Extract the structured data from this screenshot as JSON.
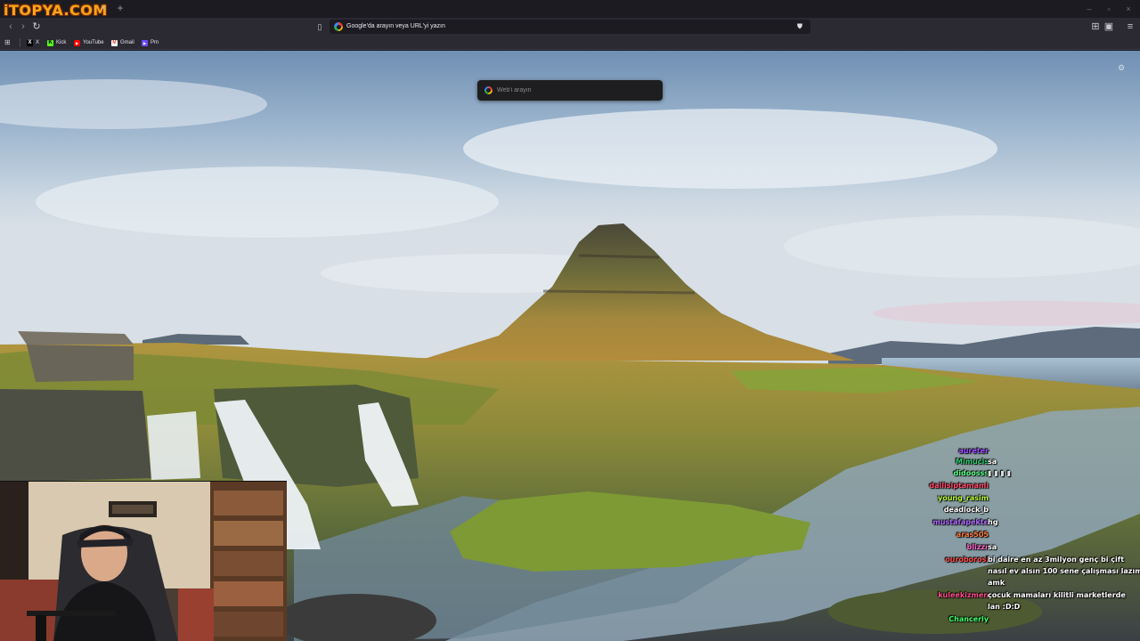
{
  "watermark": {
    "text": "iTOPYA.COM"
  },
  "tabbar": {
    "close_glyph": "×",
    "new_tab_glyph": "+",
    "window_controls": [
      "–",
      "▫",
      "×"
    ]
  },
  "navbar": {
    "back_glyph": "‹",
    "forward_glyph": "›",
    "reload_glyph": "↻",
    "bookmark_glyph": "▯",
    "url_placeholder": "Google'da arayın veya URL'yi yazın",
    "shield_glyph": "⛊",
    "right_icons": [
      "⊞",
      "▣",
      "≡"
    ]
  },
  "bookmarks": {
    "apps_glyph": "⊞",
    "items": [
      {
        "label": "X",
        "icon": "x-icon",
        "glyph": "𝕏",
        "color": "#ffffff",
        "bg": "#000000"
      },
      {
        "label": "Kick",
        "icon": "kick-icon",
        "glyph": "K",
        "color": "#000000",
        "bg": "#53fc18"
      },
      {
        "label": "YouTube",
        "icon": "youtube-icon",
        "glyph": "▶",
        "color": "#ffffff",
        "bg": "#ff0000"
      },
      {
        "label": "Gmail",
        "icon": "gmail-icon",
        "glyph": "M",
        "color": "#ea4335",
        "bg": "#ffffff"
      },
      {
        "label": "Pm",
        "icon": "proton-icon",
        "glyph": "▶",
        "color": "#ffffff",
        "bg": "#6d4aff"
      }
    ]
  },
  "newtab": {
    "search_placeholder": "Web'i arayın",
    "settings_glyph": "⚙"
  },
  "chat": {
    "messages": [
      {
        "user": "aureter",
        "user_color": "#9b4dff",
        "text": ""
      },
      {
        "user": "Mimucis",
        "user_color": "#2ecc71",
        "text": "sa"
      },
      {
        "user": "didoosss",
        "user_color": "#5cff8a",
        "text": "▮ ▮ ▮ ▮"
      },
      {
        "user": "dailisiptamami",
        "user_color": "#ff4d6d",
        "text": ""
      },
      {
        "user": "young_rasim",
        "user_color": "#b7ff3c",
        "text": ""
      },
      {
        "user": "deadlock_b",
        "user_color": "#ffffff",
        "text": ""
      },
      {
        "user": "mustafapekte",
        "user_color": "#b06bff",
        "text": "hg"
      },
      {
        "user": "aras505",
        "user_color": "#ff7a3c",
        "text": ""
      },
      {
        "user": "blizzr",
        "user_color": "#ff66cc",
        "text": "sa"
      },
      {
        "user": "ouroborosl",
        "user_color": "#ff4d4d",
        "text": "bi daire en az 3milyon genç bi çift"
      },
      {
        "user": "",
        "user_color": "#ffffff",
        "text": "nasıl ev alsın 100 sene çalışması lazım"
      },
      {
        "user": "",
        "user_color": "#ffffff",
        "text": "amk"
      },
      {
        "user": "kuleekizmen",
        "user_color": "#ff4d8d",
        "text": "çocuk mamaları kilitli marketlerde"
      },
      {
        "user": "",
        "user_color": "#ffffff",
        "text": "lan :D:D"
      },
      {
        "user": "Chancerly",
        "user_color": "#3cff6a",
        "text": ""
      }
    ]
  }
}
